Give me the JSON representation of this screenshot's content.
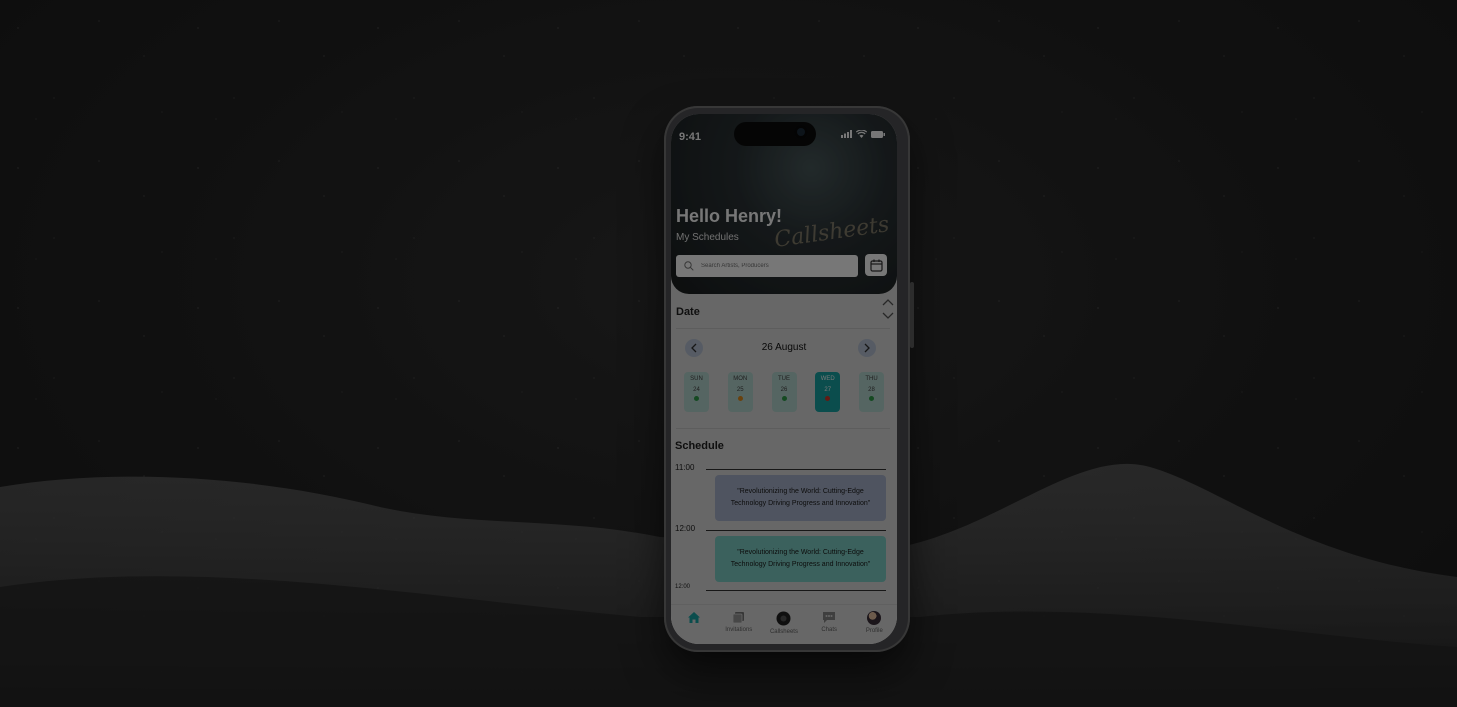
{
  "status": {
    "time": "9:41"
  },
  "hero": {
    "greeting": "Hello Henry!",
    "subtitle": "My Schedules",
    "logo_text": "Callsheets",
    "search_placeholder": "Search Artists, Producers"
  },
  "date_section": {
    "title": "Date",
    "month_label": "26 August",
    "days": [
      {
        "name": "SUN",
        "num": "24",
        "dot_color": "#2e9e4a",
        "active": false
      },
      {
        "name": "MON",
        "num": "25",
        "dot_color": "#e08a1e",
        "active": false
      },
      {
        "name": "TUE",
        "num": "26",
        "dot_color": "#2e9e4a",
        "active": false
      },
      {
        "name": "WED",
        "num": "27",
        "dot_color": "#d33a2c",
        "active": true
      },
      {
        "name": "THU",
        "num": "28",
        "dot_color": "#2e9e4a",
        "active": false
      }
    ]
  },
  "schedule": {
    "title": "Schedule",
    "times": [
      "11:00",
      "12:00",
      "12:00"
    ],
    "events": [
      {
        "text": "\"Revolutionizing the World: Cutting-Edge Technology Driving Progress and Innovation\"",
        "color": "#a9b4cc"
      },
      {
        "text": "\"Revolutionizing the World: Cutting-Edge Technology Driving Progress and Innovation\"",
        "color": "#7fd0c6"
      }
    ]
  },
  "tabbar": {
    "items": [
      {
        "label": "Home",
        "icon": "home-icon"
      },
      {
        "label": "Invitations",
        "icon": "invitations-icon"
      },
      {
        "label": "Callsheets",
        "icon": "callsheets-icon"
      },
      {
        "label": "Chats",
        "icon": "chats-icon"
      },
      {
        "label": "Profile",
        "icon": "profile-icon"
      }
    ]
  },
  "colors": {
    "accent": "#1aa5a5"
  }
}
